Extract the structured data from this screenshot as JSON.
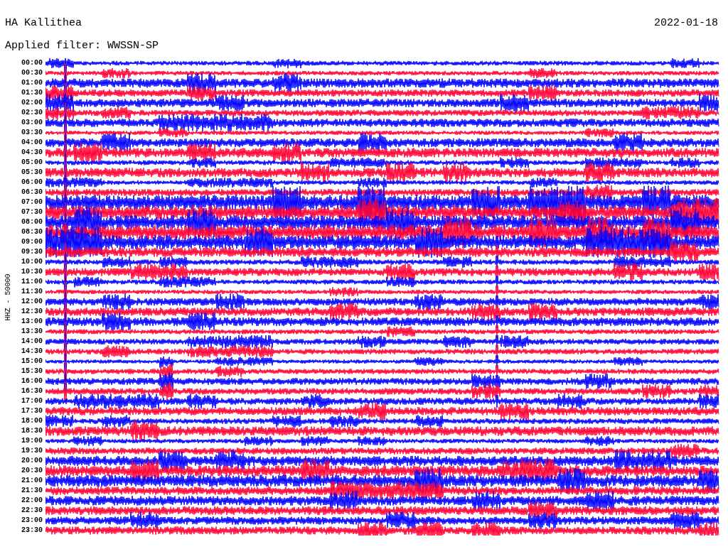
{
  "station": "HA Kallithea",
  "date": "2022-01-18",
  "filter": "Applied filter: WWSSN-SP",
  "channel": "HHZ - 50000",
  "rows": [
    {
      "time": "00:00",
      "color": "#0000ff"
    },
    {
      "time": "00:30",
      "color": "#ff0033"
    },
    {
      "time": "01:00",
      "color": "#0000ff"
    },
    {
      "time": "01:30",
      "color": "#ff0033"
    },
    {
      "time": "02:00",
      "color": "#0000ff"
    },
    {
      "time": "02:30",
      "color": "#ff0033"
    },
    {
      "time": "03:00",
      "color": "#0000ff"
    },
    {
      "time": "03:30",
      "color": "#ff0033"
    },
    {
      "time": "04:00",
      "color": "#0000ff"
    },
    {
      "time": "04:30",
      "color": "#ff0033"
    },
    {
      "time": "05:00",
      "color": "#0000ff"
    },
    {
      "time": "05:30",
      "color": "#ff0033"
    },
    {
      "time": "06:00",
      "color": "#0000ff"
    },
    {
      "time": "06:30",
      "color": "#ff0033"
    },
    {
      "time": "07:00",
      "color": "#0000ff"
    },
    {
      "time": "07:30",
      "color": "#ff0033"
    },
    {
      "time": "08:00",
      "color": "#0000ff"
    },
    {
      "time": "08:30",
      "color": "#ff0033"
    },
    {
      "time": "09:00",
      "color": "#0000ff"
    },
    {
      "time": "09:30",
      "color": "#ff0033"
    },
    {
      "time": "10:00",
      "color": "#0000ff"
    },
    {
      "time": "10:30",
      "color": "#ff0033"
    },
    {
      "time": "11:00",
      "color": "#0000ff"
    },
    {
      "time": "11:30",
      "color": "#ff0033"
    },
    {
      "time": "12:00",
      "color": "#0000ff"
    },
    {
      "time": "12:30",
      "color": "#ff0033"
    },
    {
      "time": "13:00",
      "color": "#0000ff"
    },
    {
      "time": "13:30",
      "color": "#ff0033"
    },
    {
      "time": "14:00",
      "color": "#0000ff"
    },
    {
      "time": "14:30",
      "color": "#ff0033"
    },
    {
      "time": "15:00",
      "color": "#0000ff"
    },
    {
      "time": "15:30",
      "color": "#ff0033"
    },
    {
      "time": "16:00",
      "color": "#0000ff"
    },
    {
      "time": "16:30",
      "color": "#ff0033"
    },
    {
      "time": "17:00",
      "color": "#0000ff"
    },
    {
      "time": "17:30",
      "color": "#ff0033"
    },
    {
      "time": "18:00",
      "color": "#0000ff"
    },
    {
      "time": "18:30",
      "color": "#ff0033"
    },
    {
      "time": "19:00",
      "color": "#0000ff"
    },
    {
      "time": "19:30",
      "color": "#ff0033"
    },
    {
      "time": "20:00",
      "color": "#0000ff"
    },
    {
      "time": "20:30",
      "color": "#ff0033"
    },
    {
      "time": "21:00",
      "color": "#0000ff"
    },
    {
      "time": "21:30",
      "color": "#ff0033"
    },
    {
      "time": "22:00",
      "color": "#0000ff"
    },
    {
      "time": "22:30",
      "color": "#ff0033"
    },
    {
      "time": "23:00",
      "color": "#0000ff"
    },
    {
      "time": "23:30",
      "color": "#ff0033"
    }
  ]
}
